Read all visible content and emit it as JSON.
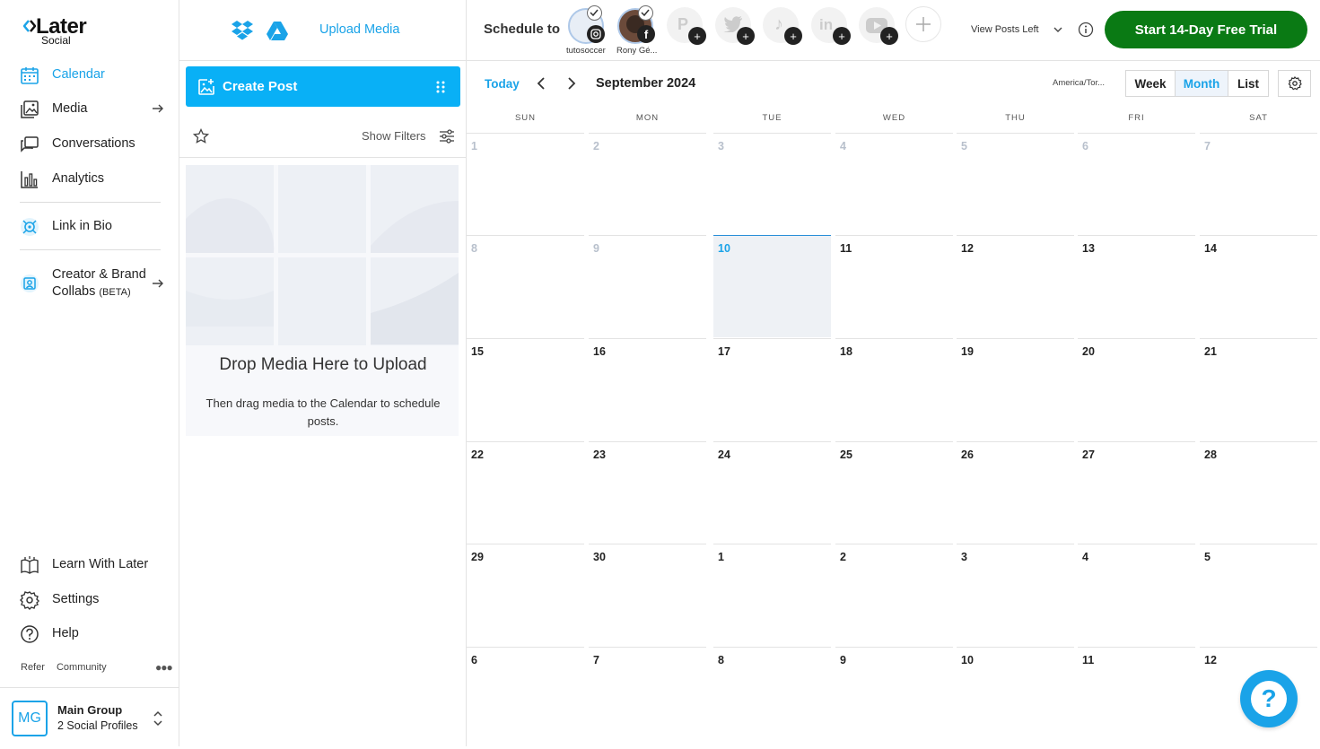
{
  "brand": {
    "name": "Later",
    "sub": "Social"
  },
  "sidebar": {
    "items": [
      {
        "label": "Calendar",
        "icon": "calendar-icon",
        "active": true
      },
      {
        "label": "Media",
        "icon": "media-icon"
      },
      {
        "label": "Conversations",
        "icon": "conversations-icon"
      },
      {
        "label": "Analytics",
        "icon": "analytics-icon"
      },
      {
        "label": "Link in Bio",
        "icon": "link-in-bio-icon"
      },
      {
        "label": "Creator & Brand",
        "label2": "Collabs",
        "beta": "(BETA)",
        "icon": "creator-collabs-icon"
      }
    ],
    "bottom": [
      {
        "label": "Learn With Later",
        "icon": "learn-icon"
      },
      {
        "label": "Settings",
        "icon": "gear-icon"
      },
      {
        "label": "Help",
        "icon": "help-icon"
      }
    ],
    "footer_links": [
      "Refer",
      "Community"
    ],
    "group": {
      "initials": "MG",
      "name": "Main Group",
      "sub": "2 Social Profiles"
    }
  },
  "media": {
    "upload_label": "Upload Media",
    "create_label": "Create Post",
    "filters_label": "Show Filters",
    "drop_title": "Drop Media Here to Upload",
    "drop_sub": "Then drag media to the Calendar to schedule posts."
  },
  "header": {
    "schedule_label": "Schedule to",
    "accounts": [
      {
        "name": "tutosoccer",
        "network": "instagram"
      },
      {
        "name": "Rony Gé...",
        "network": "facebook"
      }
    ],
    "view_posts_left": "View Posts Left",
    "trial_label": "Start 14-Day Free Trial"
  },
  "toolbar": {
    "today": "Today",
    "month_title": "September 2024",
    "timezone": "America/Tor...",
    "views": [
      "Week",
      "Month",
      "List"
    ],
    "active_view": "Month"
  },
  "calendar": {
    "days_of_week": [
      "SUN",
      "MON",
      "TUE",
      "WED",
      "THU",
      "FRI",
      "SAT"
    ],
    "weeks": [
      [
        "1",
        "2",
        "3",
        "4",
        "5",
        "6",
        "7"
      ],
      [
        "8",
        "9",
        "10",
        "11",
        "12",
        "13",
        "14"
      ],
      [
        "15",
        "16",
        "17",
        "18",
        "19",
        "20",
        "21"
      ],
      [
        "22",
        "23",
        "24",
        "25",
        "26",
        "27",
        "28"
      ],
      [
        "29",
        "30",
        "1",
        "2",
        "3",
        "4",
        "5"
      ],
      [
        "6",
        "7",
        "8",
        "9",
        "10",
        "11",
        "12"
      ]
    ],
    "muted": [
      "0-0",
      "0-1",
      "0-2",
      "0-3",
      "0-4",
      "0-5",
      "0-6",
      "1-0",
      "1-1"
    ],
    "today_cell": "1-2"
  },
  "colors": {
    "accent": "#1aa3e8",
    "create": "#09b0f6",
    "trial": "#0a7a14"
  }
}
